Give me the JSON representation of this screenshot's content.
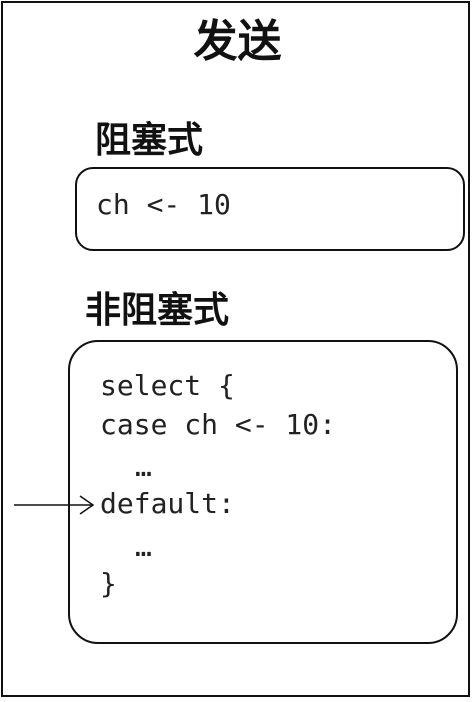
{
  "title": "发送",
  "blocking": {
    "label": "阻塞式",
    "code": "ch <- 10"
  },
  "nonblocking": {
    "label": "非阻塞式",
    "code_lines": [
      "select {",
      "case ch <- 10:",
      "…",
      "default:",
      "…",
      "}"
    ]
  }
}
